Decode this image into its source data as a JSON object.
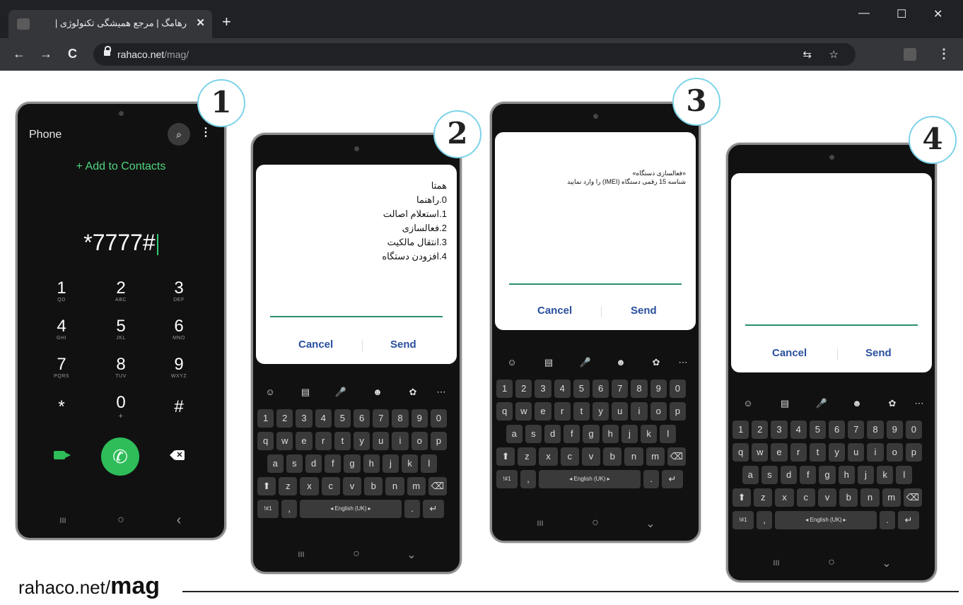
{
  "browser": {
    "tab_title": "رهامگ | مرجع همیشگی تکنولوژی |",
    "tab_close": "✕",
    "new_tab": "+",
    "win_min": "—",
    "win_max": "☐",
    "win_close": "✕",
    "back": "←",
    "forward": "→",
    "reload": "C",
    "url_domain": "rahaco.net",
    "url_path": "/mag/",
    "translate_icon": "⇆",
    "star_icon": "☆",
    "menu_icon": "⋮"
  },
  "steps": [
    "1",
    "2",
    "3",
    "4"
  ],
  "phone1": {
    "title": "Phone",
    "search_icon": "⌕",
    "more_icon": "⋮",
    "add_contacts": "+ Add to Contacts",
    "entry": "*7777#",
    "keys": [
      {
        "d": "1",
        "l": "QD"
      },
      {
        "d": "2",
        "l": "ABC"
      },
      {
        "d": "3",
        "l": "DEF"
      },
      {
        "d": "4",
        "l": "GHI"
      },
      {
        "d": "5",
        "l": "JKL"
      },
      {
        "d": "6",
        "l": "MNO"
      },
      {
        "d": "7",
        "l": "PQRS"
      },
      {
        "d": "8",
        "l": "TUV"
      },
      {
        "d": "9",
        "l": "WXYZ"
      },
      {
        "d": "*",
        "l": ""
      },
      {
        "d": "0",
        "l": "+"
      },
      {
        "d": "#",
        "l": ""
      }
    ],
    "call_icon": "✆",
    "backspace_icon": "✕"
  },
  "nav": {
    "recents": "III",
    "home": "○",
    "back": "‹",
    "hide": "⌄"
  },
  "ussd_menu": {
    "lines": [
      "همتا",
      "0.راهنما",
      "1.استعلام اصالت",
      "2.فعالسازی",
      "3.انتقال مالکیت",
      "4.افزودن دستگاه"
    ],
    "cancel": "Cancel",
    "send": "Send"
  },
  "ussd_activate": {
    "lines": [
      "«فعالسازی دستگاه»",
      "شناسه 15 رقمی دستگاه (IMEI) را وارد نمایید"
    ],
    "cancel": "Cancel",
    "send": "Send"
  },
  "ussd_result": {
    "cancel": "Cancel",
    "send": "Send"
  },
  "keyboard": {
    "toolbar_icons": [
      "☺",
      "▤",
      "🎤",
      "☻",
      "✿",
      "⋯"
    ],
    "row_numbers": [
      "1",
      "2",
      "3",
      "4",
      "5",
      "6",
      "7",
      "8",
      "9",
      "0"
    ],
    "row_q": [
      "q",
      "w",
      "e",
      "r",
      "t",
      "y",
      "u",
      "i",
      "o",
      "p"
    ],
    "row_a": [
      "a",
      "s",
      "d",
      "f",
      "g",
      "h",
      "j",
      "k",
      "l"
    ],
    "row_z": [
      "⬆",
      "z",
      "x",
      "c",
      "v",
      "b",
      "n",
      "m",
      "⌫"
    ],
    "row_bottom": {
      "sym": "!#1",
      "comma": ",",
      "space": "◂ English (UK) ▸",
      "period": ".",
      "enter": "↵"
    }
  },
  "footer": {
    "brand_prefix": "rahaco.net/",
    "brand_suffix": "mag"
  }
}
